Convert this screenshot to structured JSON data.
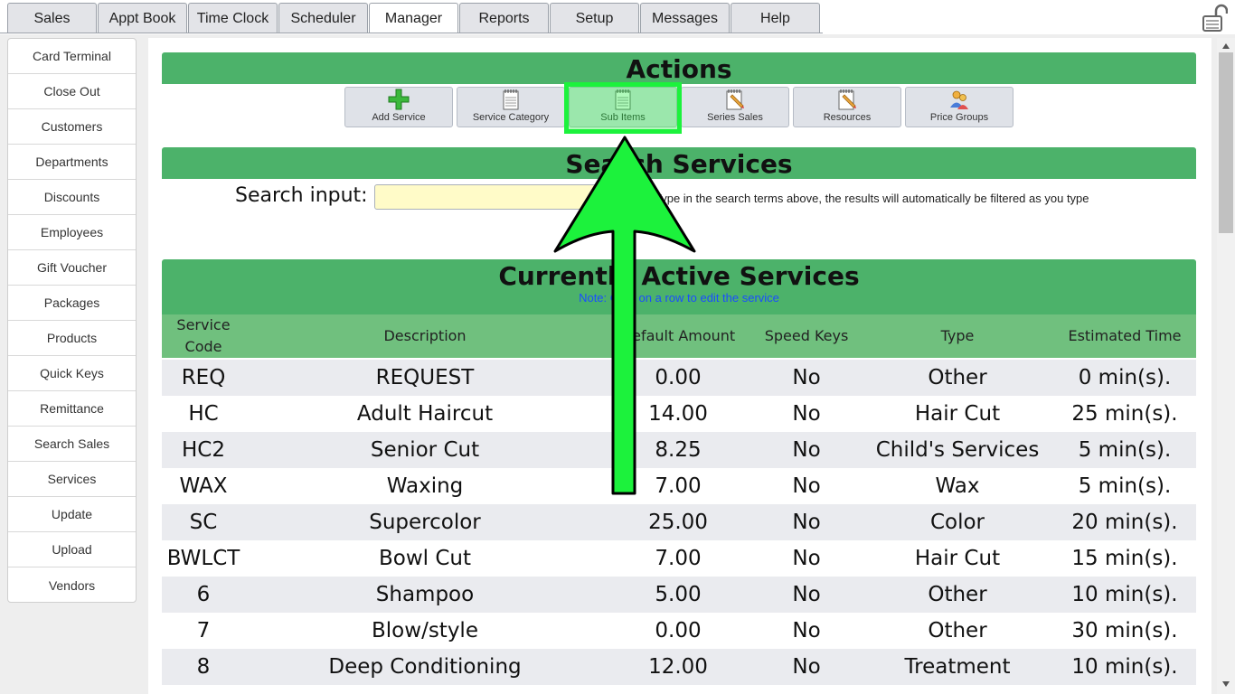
{
  "tabs": [
    {
      "label": "Sales",
      "active": false
    },
    {
      "label": "Appt Book",
      "active": false
    },
    {
      "label": "Time Clock",
      "active": false
    },
    {
      "label": "Scheduler",
      "active": false
    },
    {
      "label": "Manager",
      "active": true
    },
    {
      "label": "Reports",
      "active": false
    },
    {
      "label": "Setup",
      "active": false
    },
    {
      "label": "Messages",
      "active": false
    },
    {
      "label": "Help",
      "active": false
    }
  ],
  "sidebar": {
    "items": [
      {
        "label": "Card Terminal"
      },
      {
        "label": "Close Out"
      },
      {
        "label": "Customers"
      },
      {
        "label": "Departments"
      },
      {
        "label": "Discounts"
      },
      {
        "label": "Employees"
      },
      {
        "label": "Gift Voucher"
      },
      {
        "label": "Packages"
      },
      {
        "label": "Products"
      },
      {
        "label": "Quick Keys"
      },
      {
        "label": "Remittance"
      },
      {
        "label": "Search Sales"
      },
      {
        "label": "Services"
      },
      {
        "label": "Update"
      },
      {
        "label": "Upload"
      },
      {
        "label": "Vendors"
      }
    ]
  },
  "actions": {
    "title": "Actions",
    "buttons": [
      {
        "label": "Add Service",
        "icon": "plus-icon"
      },
      {
        "label": "Service Category",
        "icon": "notepad-icon"
      },
      {
        "label": "Sub Items",
        "icon": "notepad-icon"
      },
      {
        "label": "Series Sales",
        "icon": "pencil-notepad-icon"
      },
      {
        "label": "Resources",
        "icon": "pencil-notepad-icon"
      },
      {
        "label": "Price Groups",
        "icon": "people-icon"
      }
    ]
  },
  "search": {
    "title": "Search Services",
    "label": "Search input:",
    "value": "",
    "placeholder": "",
    "hint": "Type in the search terms above, the results will automatically be filtered as you type"
  },
  "services": {
    "title": "Currently Active Services",
    "note": "Note: Click on a row to edit the service",
    "headers": {
      "code": "Service Code",
      "description": "Description",
      "amount": "Default Amount",
      "speed_keys": "Speed Keys",
      "type": "Type",
      "time": "Estimated Time"
    },
    "rows": [
      {
        "code": "REQ",
        "description": "REQUEST",
        "amount": "0.00",
        "speed_keys": "No",
        "type": "Other",
        "time": "0 min(s)."
      },
      {
        "code": "HC",
        "description": "Adult Haircut",
        "amount": "14.00",
        "speed_keys": "No",
        "type": "Hair Cut",
        "time": "25 min(s)."
      },
      {
        "code": "HC2",
        "description": "Senior Cut",
        "amount": "8.25",
        "speed_keys": "No",
        "type": "Child's Services",
        "time": "5 min(s)."
      },
      {
        "code": "WAX",
        "description": "Waxing",
        "amount": "7.00",
        "speed_keys": "No",
        "type": "Wax",
        "time": "5 min(s)."
      },
      {
        "code": "SC",
        "description": "Supercolor",
        "amount": "25.00",
        "speed_keys": "No",
        "type": "Color",
        "time": "20 min(s)."
      },
      {
        "code": "BWLCT",
        "description": "Bowl Cut",
        "amount": "7.00",
        "speed_keys": "No",
        "type": "Hair Cut",
        "time": "15 min(s)."
      },
      {
        "code": "6",
        "description": "Shampoo",
        "amount": "5.00",
        "speed_keys": "No",
        "type": "Other",
        "time": "10 min(s)."
      },
      {
        "code": "7",
        "description": "Blow/style",
        "amount": "0.00",
        "speed_keys": "No",
        "type": "Other",
        "time": "30 min(s)."
      },
      {
        "code": "8",
        "description": "Deep Conditioning",
        "amount": "12.00",
        "speed_keys": "No",
        "type": "Treatment",
        "time": "10 min(s)."
      }
    ]
  },
  "annotation": {
    "arrow_color": "#1cf23c",
    "target": "Sub Items"
  },
  "colors": {
    "section_green": "#4cb26a",
    "header_green": "#70c07e",
    "row_alt": "#eaebef",
    "input_yellow": "#fffbc8"
  }
}
